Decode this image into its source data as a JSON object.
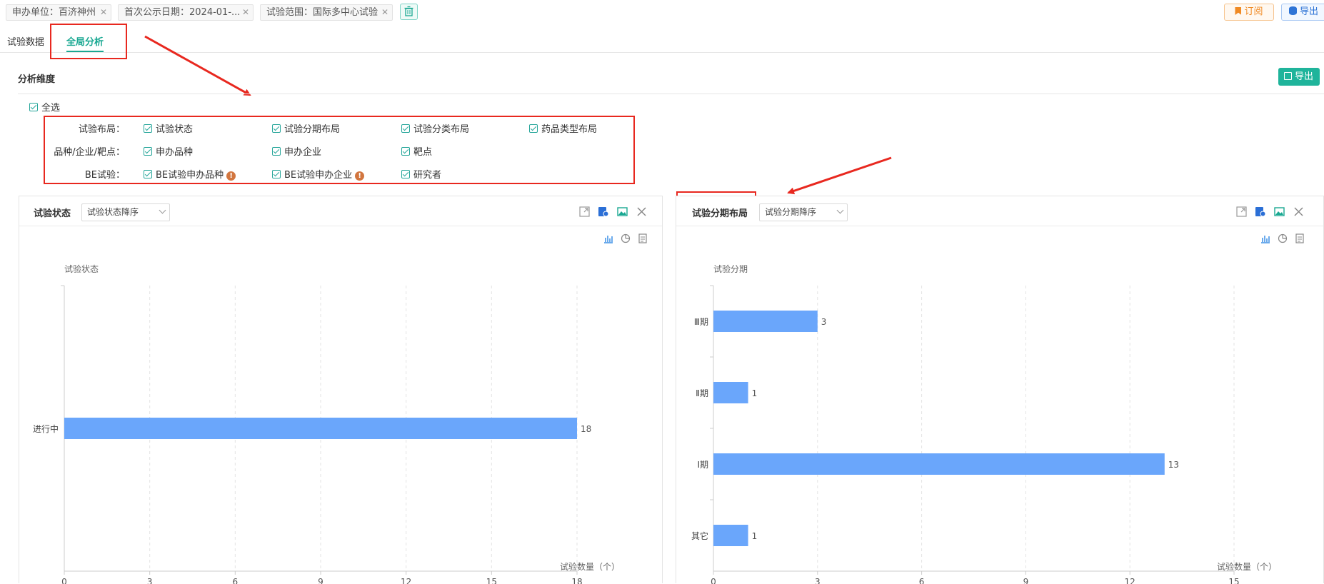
{
  "filters": [
    {
      "label": "申办单位：百济神州"
    },
    {
      "label": "首次公示日期：2024-01-..."
    },
    {
      "label": "试验范围：国际多中心试验"
    }
  ],
  "actions": {
    "subscribe": "订阅",
    "export_top": "导出"
  },
  "tabs": [
    {
      "label": "试验数据"
    },
    {
      "label": "全局分析"
    }
  ],
  "section": {
    "title": "分析维度",
    "export": "导出",
    "select_all": "全选"
  },
  "dimension_rows": [
    {
      "label": "试验布局：",
      "options": [
        "试验状态",
        "试验分期布局",
        "试验分类布局",
        "药品类型布局"
      ]
    },
    {
      "label": "品种/企业/靶点：",
      "options": [
        "申办品种",
        "申办企业",
        "靶点"
      ]
    },
    {
      "label": "BE试验：",
      "options": [
        "BE试验申办品种",
        "BE试验申办企业",
        "研究者"
      ]
    }
  ],
  "panels": [
    {
      "title": "试验状态",
      "sort": "试验状态降序"
    },
    {
      "title": "试验分期布局",
      "sort": "试验分期降序"
    }
  ],
  "colors": {
    "accent": "#19a892",
    "bar": "#6aa6fb",
    "annotation": "#e8281f"
  },
  "chart_data": [
    {
      "type": "bar",
      "orientation": "horizontal",
      "categories": [
        "进行中"
      ],
      "values": [
        18
      ],
      "ylabel": "试验状态",
      "xlabel": "试验数量（个）",
      "xlim": [
        0,
        18
      ],
      "xticks": [
        0,
        3,
        6,
        9,
        12,
        15,
        18
      ],
      "grid": true
    },
    {
      "type": "bar",
      "orientation": "horizontal",
      "categories": [
        "Ⅲ期",
        "Ⅱ期",
        "Ⅰ期",
        "其它"
      ],
      "values": [
        3,
        1,
        13,
        1
      ],
      "ylabel": "试验分期",
      "xlabel": "试验数量（个）",
      "xlim": [
        0,
        15
      ],
      "xticks": [
        0,
        3,
        6,
        9,
        12,
        15
      ],
      "grid": true
    }
  ]
}
